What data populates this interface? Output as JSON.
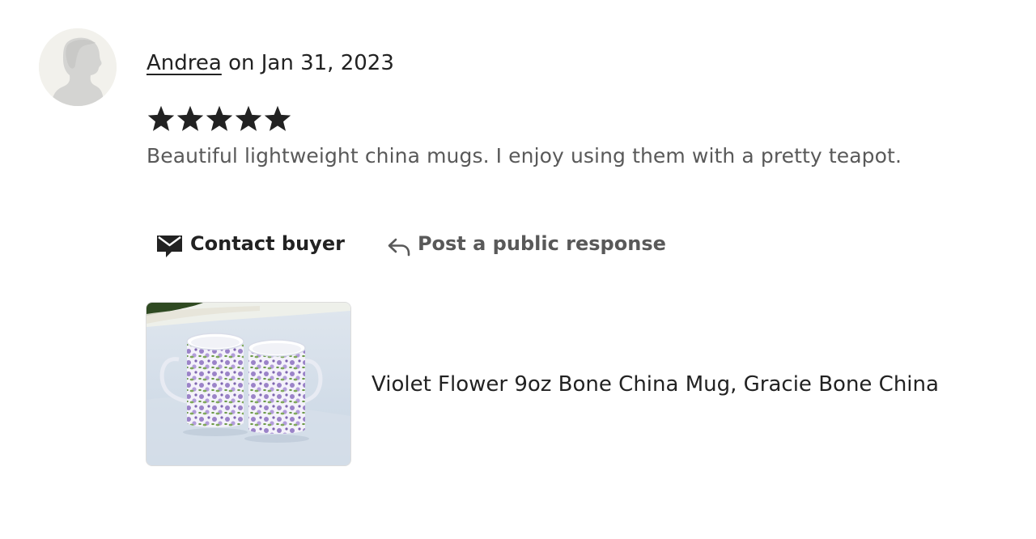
{
  "reviewer": {
    "name": "Andrea",
    "date_text": " on Jan 31, 2023"
  },
  "rating": {
    "stars": 5,
    "max": 5
  },
  "review": {
    "text": "Beautiful lightweight china mugs. I enjoy using them with a pretty teapot."
  },
  "actions": {
    "contact_label": "Contact buyer",
    "contact_icon": "envelope-icon",
    "respond_label": "Post a public response",
    "respond_icon": "reply-arrow-icon"
  },
  "listing": {
    "title": "Violet Flower 9oz Bone China Mug, Gracie Bone China",
    "image_icon": "product-photo"
  },
  "colors": {
    "text_primary": "#222222",
    "text_secondary": "#595959",
    "avatar_bg": "#f2f1ec",
    "avatar_silhouette": "#d4d4d2"
  }
}
